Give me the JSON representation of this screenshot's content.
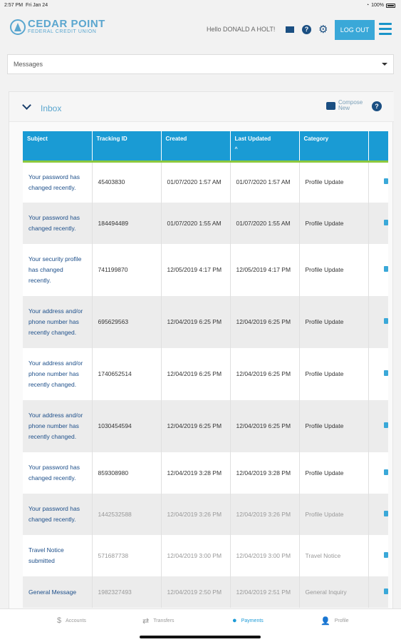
{
  "status_bar": {
    "time": "2:57 PM",
    "date": "Fri Jan 24",
    "battery": "100%"
  },
  "header": {
    "logo_line1": "CEDAR POINT",
    "logo_line2": "FEDERAL CREDIT UNION",
    "greeting": "Hello DONALD A HOLT!",
    "logout_label": "LOG OUT",
    "icons": [
      "mail-icon",
      "help-icon",
      "gear-icon",
      "hamburger-menu-icon"
    ],
    "brand_color": "#5aa6cf",
    "accent_color": "#3aa8d8"
  },
  "selector": {
    "value": "Messages"
  },
  "inbox": {
    "title": "Inbox",
    "compose_label": "Compose New",
    "columns": [
      "Subject",
      "Tracking ID",
      "Created",
      "Last Updated",
      "Category"
    ],
    "sort_indicator": "^",
    "rows": [
      {
        "subject": "Your password has changed recently.",
        "tracking_id": "45403830",
        "created": "01/07/2020 1:57 AM",
        "updated": "01/07/2020 1:57 AM",
        "category": "Profile Update",
        "read": false
      },
      {
        "subject": "Your password has changed recently.",
        "tracking_id": "184494489",
        "created": "01/07/2020 1:55 AM",
        "updated": "01/07/2020 1:55 AM",
        "category": "Profile Update",
        "read": false
      },
      {
        "subject": "Your security profile has changed recently.",
        "tracking_id": "741199870",
        "created": "12/05/2019 4:17 PM",
        "updated": "12/05/2019 4:17 PM",
        "category": "Profile Update",
        "read": false
      },
      {
        "subject": "Your address and/or phone number has recently changed.",
        "tracking_id": "695629563",
        "created": "12/04/2019 6:25 PM",
        "updated": "12/04/2019 6:25 PM",
        "category": "Profile Update",
        "read": false
      },
      {
        "subject": "Your address and/or phone number has recently changed.",
        "tracking_id": "1740652514",
        "created": "12/04/2019 6:25 PM",
        "updated": "12/04/2019 6:25 PM",
        "category": "Profile Update",
        "read": false
      },
      {
        "subject": "Your address and/or phone number has recently changed.",
        "tracking_id": "1030454594",
        "created": "12/04/2019 6:25 PM",
        "updated": "12/04/2019 6:25 PM",
        "category": "Profile Update",
        "read": false
      },
      {
        "subject": "Your password has changed recently.",
        "tracking_id": "859308980",
        "created": "12/04/2019 3:28 PM",
        "updated": "12/04/2019 3:28 PM",
        "category": "Profile Update",
        "read": false
      },
      {
        "subject": "Your password has changed recently.",
        "tracking_id": "1442532588",
        "created": "12/04/2019 3:26 PM",
        "updated": "12/04/2019 3:26 PM",
        "category": "Profile Update",
        "read": true
      },
      {
        "subject": "Travel Notice submitted",
        "tracking_id": "571687738",
        "created": "12/04/2019 3:00 PM",
        "updated": "12/04/2019 3:00 PM",
        "category": "Travel Notice",
        "read": true
      },
      {
        "subject": "General Message",
        "tracking_id": "1982327493",
        "created": "12/04/2019 2:50 PM",
        "updated": "12/04/2019 2:51 PM",
        "category": "General Inquiry",
        "read": true
      }
    ]
  },
  "tabbar": {
    "tabs": [
      {
        "label": "Accounts",
        "icon": "$",
        "active": false
      },
      {
        "label": "Transfers",
        "icon": "⇄",
        "active": false
      },
      {
        "label": "Payments",
        "icon": "●",
        "active": true
      },
      {
        "label": "Profile",
        "icon": "👤",
        "active": false
      }
    ]
  }
}
